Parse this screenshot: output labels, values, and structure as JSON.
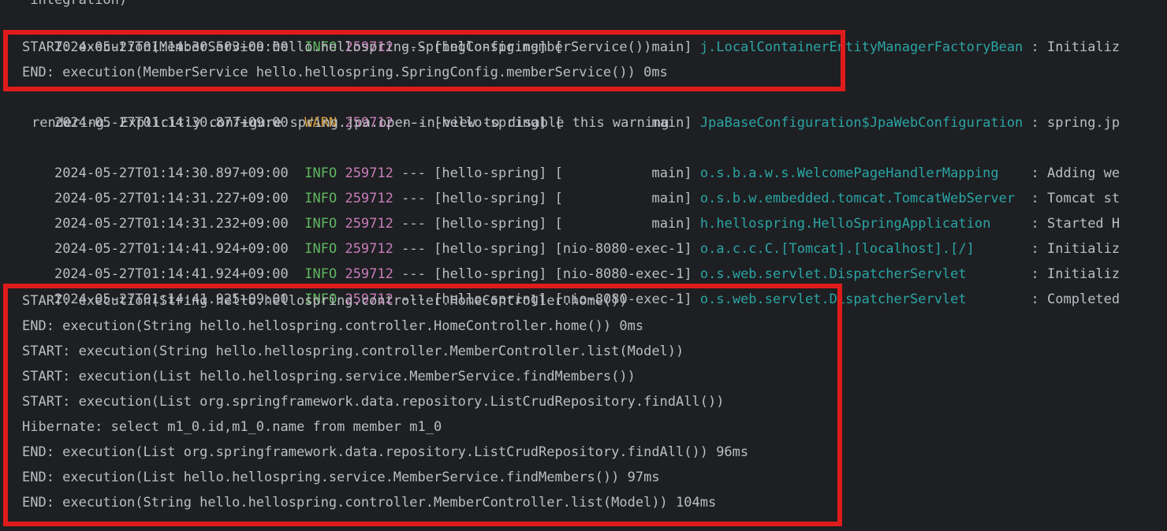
{
  "colors": {
    "background": "#1e1f22",
    "text": "#bcbec4",
    "info": "#5fb761",
    "warn": "#d8a23a",
    "pid": "#c77dbb",
    "logger": "#2aa5a5",
    "highlight": "#e01b1b"
  },
  "console": {
    "top_fragment": " integration)",
    "log_lines": [
      {
        "timestamp": "2024-05-27T01:14:30.503+09:00",
        "level": "INFO",
        "pid": "259712",
        "sep": "---",
        "app": "[hello-spring]",
        "thread": "[           main]",
        "logger": "j.LocalContainerEntityManagerFactoryBean",
        "message": ": Initializ"
      },
      {
        "timestamp": "2024-05-27T01:14:30.877+09:00",
        "level": "WARN",
        "pid": "259712",
        "sep": "---",
        "app": "[hello-spring]",
        "thread": "[           main]",
        "logger": "JpaBaseConfiguration$JpaWebConfiguration",
        "message": ": spring.jp"
      },
      {
        "timestamp": "2024-05-27T01:14:30.897+09:00",
        "level": "INFO",
        "pid": "259712",
        "sep": "---",
        "app": "[hello-spring]",
        "thread": "[           main]",
        "logger": "o.s.b.a.w.s.WelcomePageHandlerMapping   ",
        "message": ": Adding we"
      },
      {
        "timestamp": "2024-05-27T01:14:31.227+09:00",
        "level": "INFO",
        "pid": "259712",
        "sep": "---",
        "app": "[hello-spring]",
        "thread": "[           main]",
        "logger": "o.s.b.w.embedded.tomcat.TomcatWebServer ",
        "message": ": Tomcat st"
      },
      {
        "timestamp": "2024-05-27T01:14:31.232+09:00",
        "level": "INFO",
        "pid": "259712",
        "sep": "---",
        "app": "[hello-spring]",
        "thread": "[           main]",
        "logger": "h.hellospring.HelloSpringApplication    ",
        "message": ": Started H"
      },
      {
        "timestamp": "2024-05-27T01:14:41.924+09:00",
        "level": "INFO",
        "pid": "259712",
        "sep": "---",
        "app": "[hello-spring]",
        "thread": "[nio-8080-exec-1]",
        "logger": "o.a.c.c.C.[Tomcat].[localhost].[/]      ",
        "message": ": Initializ"
      },
      {
        "timestamp": "2024-05-27T01:14:41.924+09:00",
        "level": "INFO",
        "pid": "259712",
        "sep": "---",
        "app": "[hello-spring]",
        "thread": "[nio-8080-exec-1]",
        "logger": "o.s.web.servlet.DispatcherServlet       ",
        "message": ": Initializ"
      },
      {
        "timestamp": "2024-05-27T01:14:41.925+09:00",
        "level": "INFO",
        "pid": "259712",
        "sep": "---",
        "app": "[hello-spring]",
        "thread": "[nio-8080-exec-1]",
        "logger": "o.s.web.servlet.DispatcherServlet       ",
        "message": ": Completed"
      }
    ],
    "warn_continuation": "rendering. Explicitly configure spring.jpa.open-in-view to disable this warning",
    "aop_block_1": [
      "START: execution(MemberService hello.hellospring.SpringConfig.memberService())",
      "END: execution(MemberService hello.hellospring.SpringConfig.memberService()) 0ms"
    ],
    "aop_block_2": [
      "START: execution(String hello.hellospring.controller.HomeController.home())",
      "END: execution(String hello.hellospring.controller.HomeController.home()) 0ms",
      "START: execution(String hello.hellospring.controller.MemberController.list(Model))",
      "START: execution(List hello.hellospring.service.MemberService.findMembers())",
      "START: execution(List org.springframework.data.repository.ListCrudRepository.findAll())",
      "Hibernate: select m1_0.id,m1_0.name from member m1_0",
      "END: execution(List org.springframework.data.repository.ListCrudRepository.findAll()) 96ms",
      "END: execution(List hello.hellospring.service.MemberService.findMembers()) 97ms",
      "END: execution(String hello.hellospring.controller.MemberController.list(Model)) 104ms"
    ]
  }
}
